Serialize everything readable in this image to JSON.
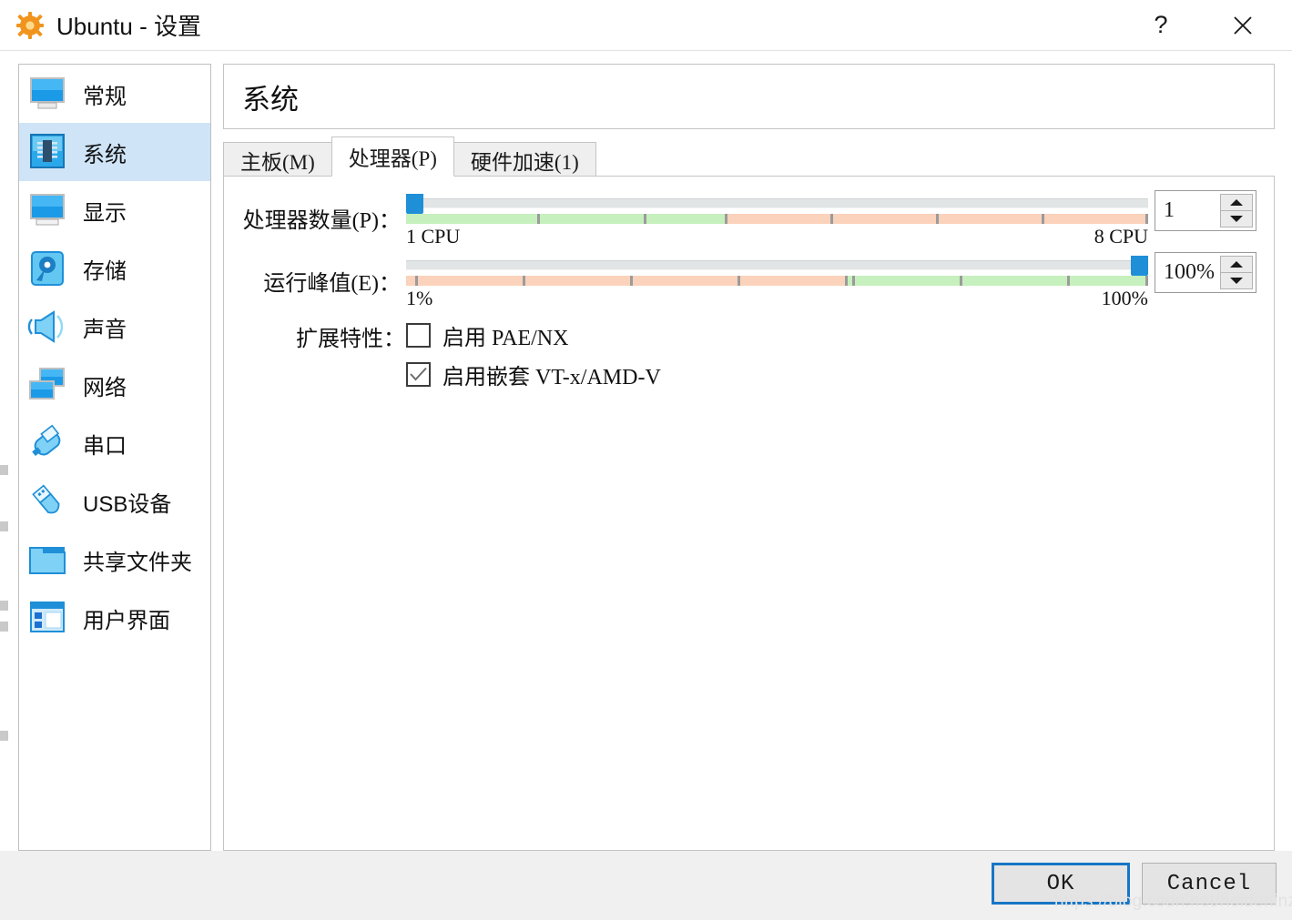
{
  "window": {
    "title": "Ubuntu - 设置",
    "icon": "virtualbox-gear-icon",
    "help_label": "?",
    "close_label": "✕"
  },
  "sidebar": {
    "items": [
      {
        "label": "常规",
        "icon": "monitor-icon",
        "selected": false
      },
      {
        "label": "系统",
        "icon": "cpu-chip-icon",
        "selected": true
      },
      {
        "label": "显示",
        "icon": "display-icon",
        "selected": false
      },
      {
        "label": "存储",
        "icon": "harddisk-icon",
        "selected": false
      },
      {
        "label": "声音",
        "icon": "speaker-icon",
        "selected": false
      },
      {
        "label": "网络",
        "icon": "network-icon",
        "selected": false
      },
      {
        "label": "串口",
        "icon": "serial-port-icon",
        "selected": false
      },
      {
        "label": "USB设备",
        "icon": "usb-icon",
        "selected": false
      },
      {
        "label": "共享文件夹",
        "icon": "folder-icon",
        "selected": false
      },
      {
        "label": "用户界面",
        "icon": "user-interface-icon",
        "selected": false
      }
    ]
  },
  "page": {
    "title": "系统",
    "tabs": [
      {
        "label": "主板(M)",
        "active": false
      },
      {
        "label": "处理器(P)",
        "active": true
      },
      {
        "label": "硬件加速(1)",
        "active": false
      }
    ]
  },
  "processor": {
    "cpu_count": {
      "label": "处理器数量(P)：",
      "min_label": "1  CPU",
      "max_label": "8  CPU",
      "value": "1",
      "segments_total": 7,
      "green_segments": 3
    },
    "exec_cap": {
      "label": "运行峰值(E)：",
      "min_label": "1%",
      "max_label": "100%",
      "value": "100%",
      "segments_total": 6,
      "orange_segments": 4
    },
    "extended_features": {
      "label": "扩展特性：",
      "checkboxes": [
        {
          "label": "启用 PAE/NX",
          "checked": false
        },
        {
          "label": "启用嵌套 VT-x/AMD-V",
          "checked": true
        }
      ]
    }
  },
  "footer": {
    "ok_label": "OK",
    "cancel_label": "Cancel"
  },
  "watermark": {
    "text": "https://blog.csdn.net/holderlinzhang"
  },
  "colors": {
    "accent_blue": "#1f8fd8",
    "selection_blue": "#cfe4f7",
    "slider_green": "#c6f0bd",
    "slider_orange": "#fbd2bb",
    "focus_border": "#1676c6"
  }
}
